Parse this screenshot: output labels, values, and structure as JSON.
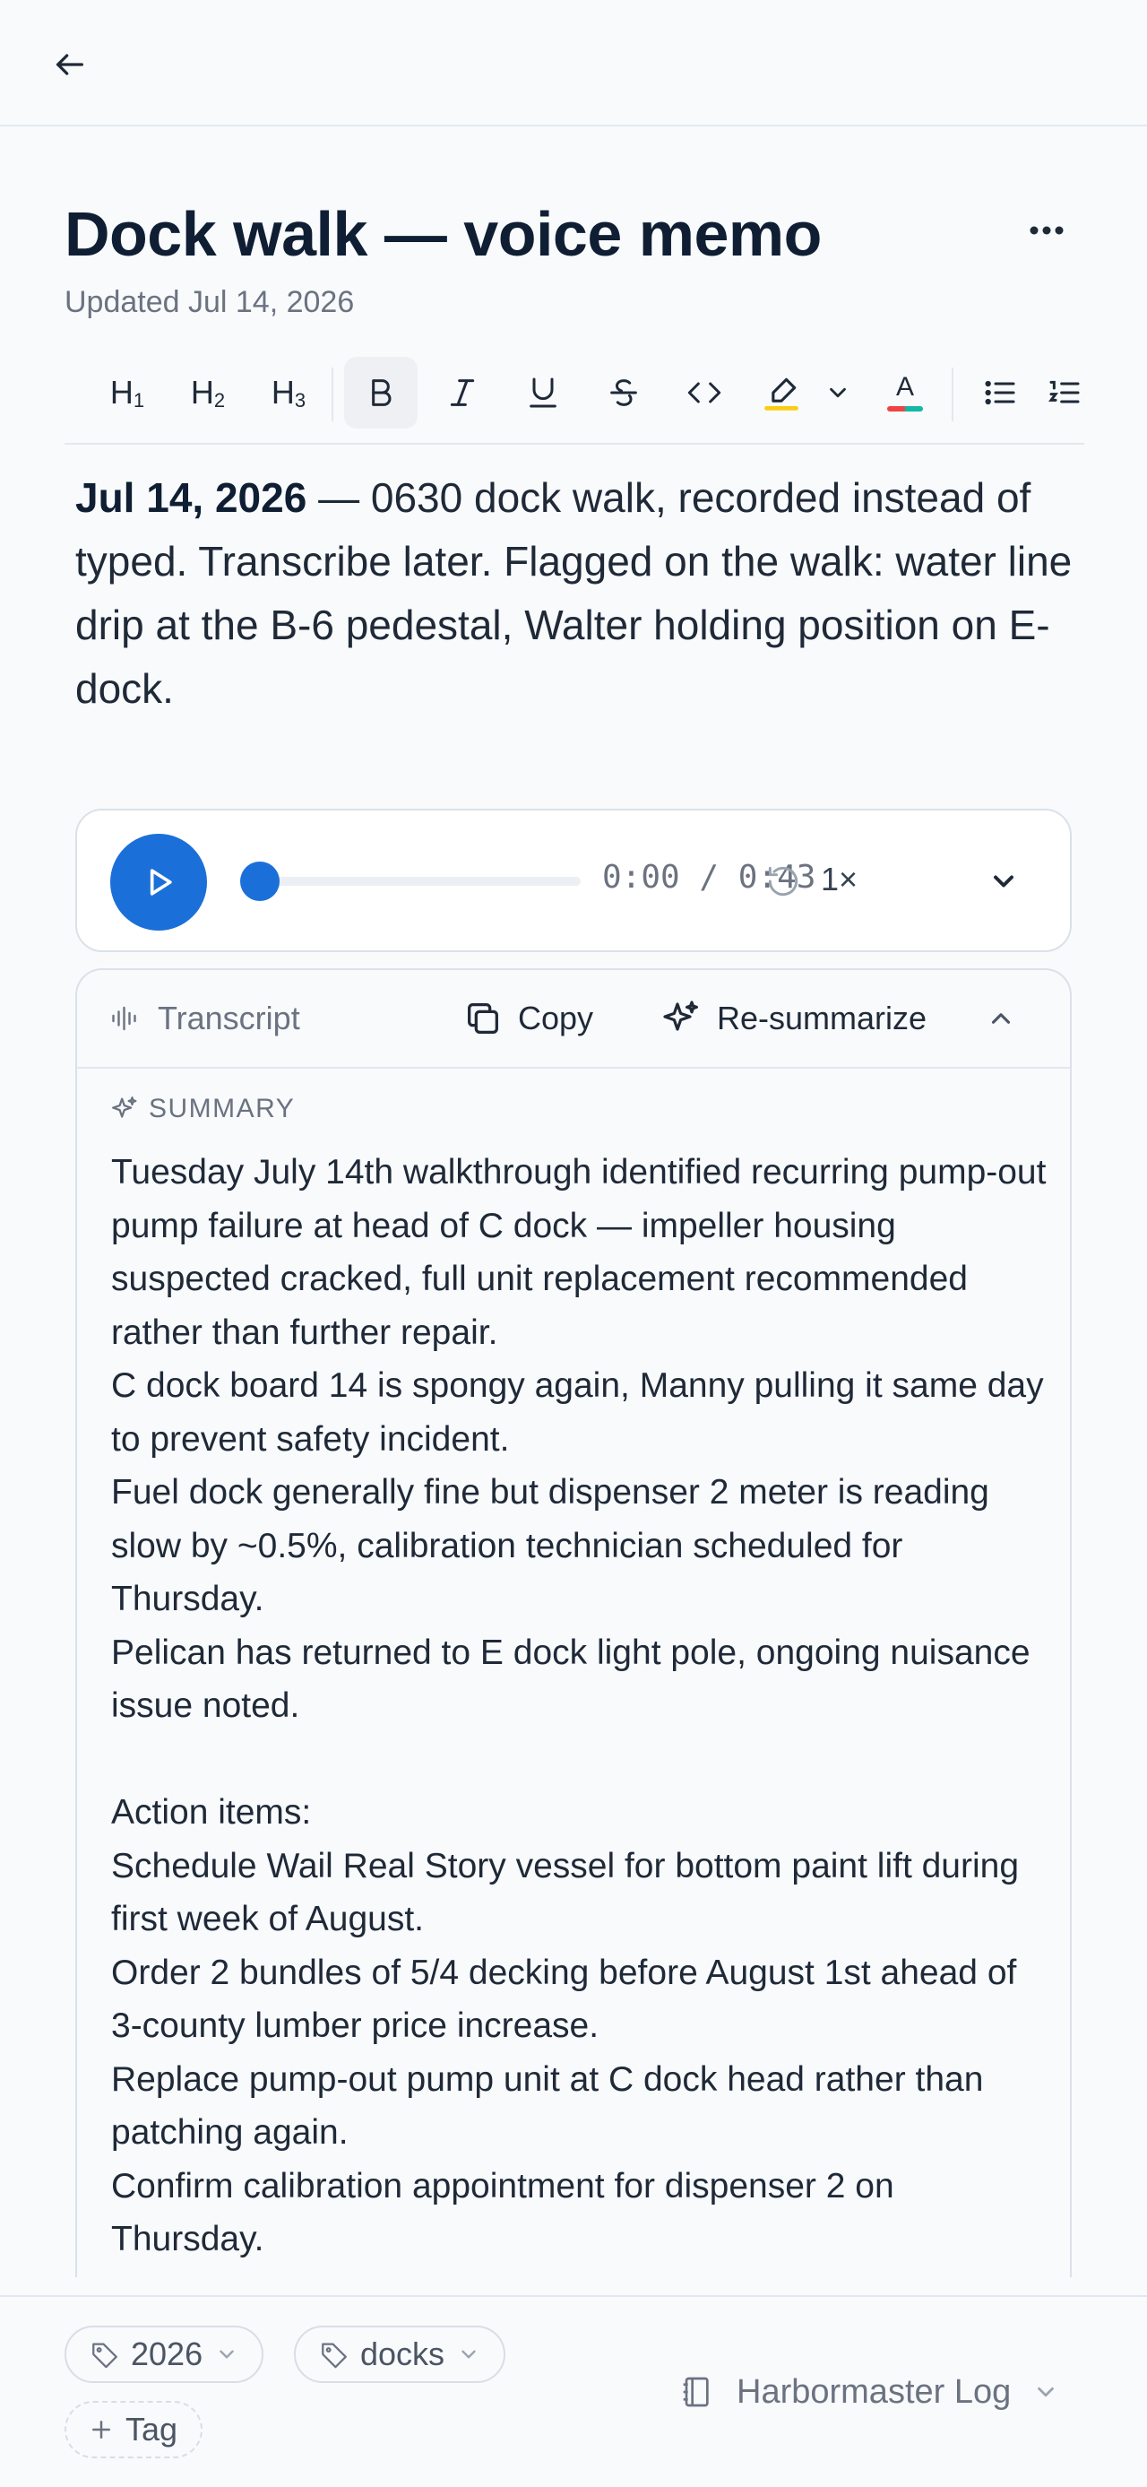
{
  "note": {
    "title": "Dock walk — voice memo",
    "updated": "Updated Jul 14, 2026",
    "body_date": "Jul 14, 2026",
    "body_rest": " — 0630 dock walk, recorded instead of typed. Transcribe later. Flagged on the walk: water line drip at the B-6 pedestal, Walter holding position on E-dock."
  },
  "toolbar": {
    "items": [
      "heading-1",
      "heading-2",
      "heading-3",
      "bold",
      "italic",
      "underline",
      "strikethrough",
      "code",
      "highlight",
      "chevron-down",
      "text-color",
      "bullet-list",
      "numbered-list"
    ],
    "h1_label": "H",
    "h1_sub": "1",
    "h2_label": "H",
    "h2_sub": "2",
    "h3_label": "H",
    "h3_sub": "3",
    "text_color_letter": "A",
    "highlight_color": "#facc15",
    "text_color_underline": [
      "#ef4444",
      "#14b8a6"
    ]
  },
  "player": {
    "time": "0:00 / 0:43",
    "rate": "1×",
    "progress": 0,
    "accent": "#1b6fd9"
  },
  "transcript": {
    "label": "Transcript",
    "copy_label": "Copy",
    "resummarize_label": "Re-summarize",
    "summary_label": "SUMMARY",
    "summary_text": "Tuesday July 14th walkthrough identified recurring pump-out pump failure at head of C dock — impeller housing suspected cracked, full unit replacement recommended rather than further repair.\nC dock board 14 is spongy again, Manny pulling it same day to prevent safety incident.\nFuel dock generally fine but dispenser 2 meter is reading slow by ~0.5%, calibration technician scheduled for Thursday.\nPelican has returned to E dock light pole, ongoing nuisance issue noted.\n\nAction items:\nSchedule Wail Real Story vessel for bottom paint lift during first week of August.\nOrder 2 bundles of 5/4 decking before August 1st ahead of 3-county lumber price increase.\nReplace pump-out pump unit at C dock head rather than patching again.\nConfirm calibration appointment for dispenser 2 on Thursday."
  },
  "footer": {
    "tags": [
      "2026",
      "docks"
    ],
    "add_tag_label": "Tag",
    "notebook": "Harbormaster Log"
  }
}
